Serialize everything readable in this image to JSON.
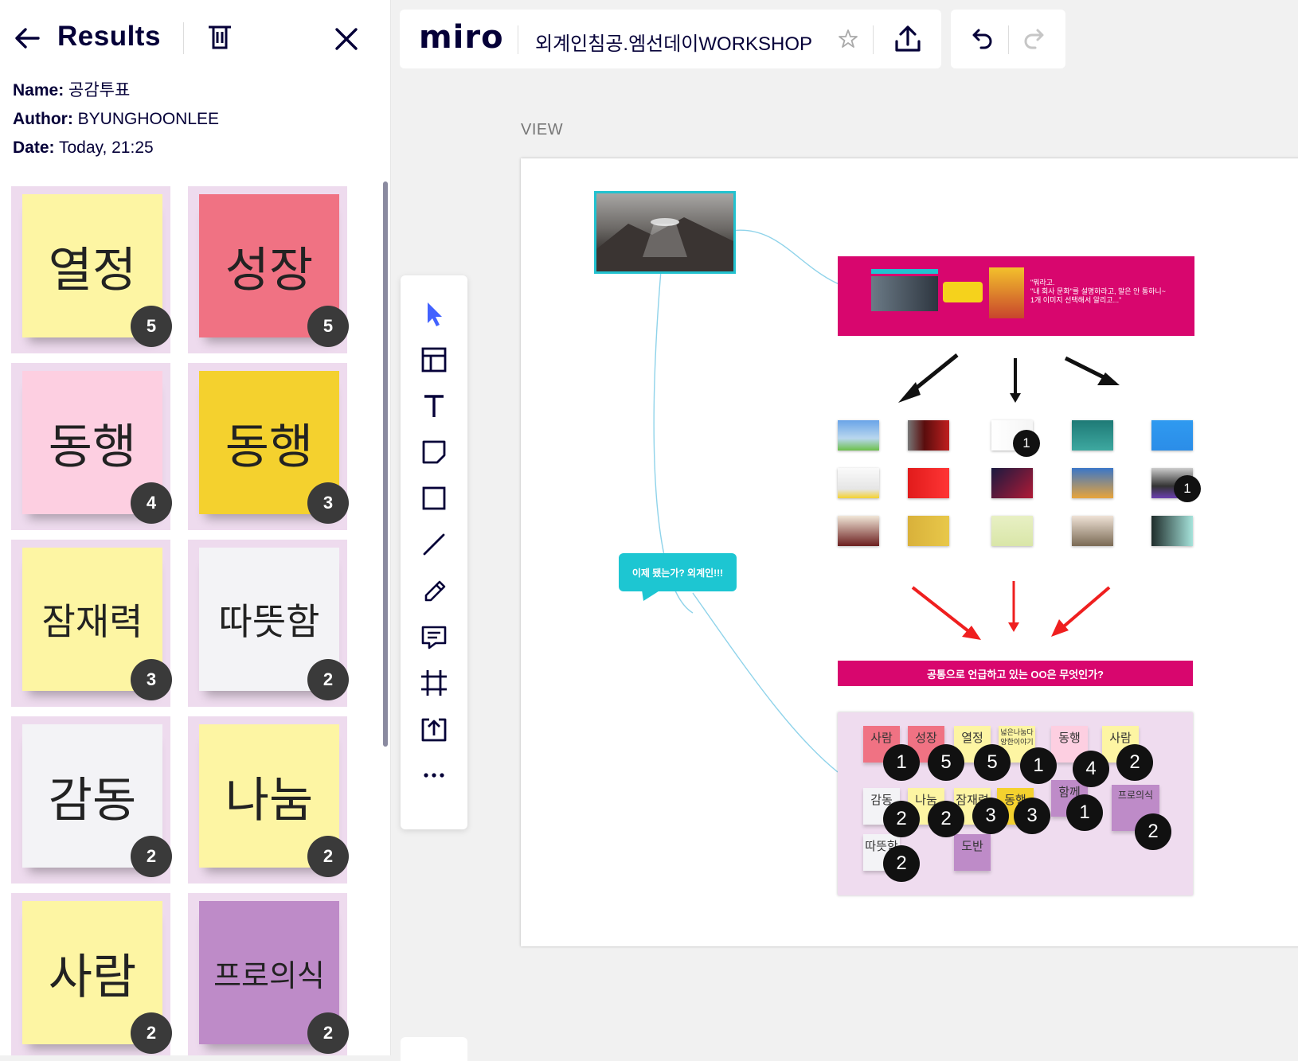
{
  "panel": {
    "title": "Results",
    "meta": [
      {
        "label": "Name:",
        "value": "공감투표"
      },
      {
        "label": "Author:",
        "value": "BYUNGHOONLEE"
      },
      {
        "label": "Date:",
        "value": "Today, 21:25"
      }
    ],
    "results": [
      {
        "word": "열정",
        "votes": "5",
        "color": "#fdf5a3"
      },
      {
        "word": "성장",
        "votes": "5",
        "color": "#f07283"
      },
      {
        "word": "동행",
        "votes": "4",
        "color": "#fdcfe1"
      },
      {
        "word": "동행",
        "votes": "3",
        "color": "#f4d12e"
      },
      {
        "word": "잠재력",
        "votes": "3",
        "color": "#fdf5a3"
      },
      {
        "word": "따뜻함",
        "votes": "2",
        "color": "#f3f3f6"
      },
      {
        "word": "감동",
        "votes": "2",
        "color": "#f3f3f6"
      },
      {
        "word": "나눔",
        "votes": "2",
        "color": "#fdf5a3"
      },
      {
        "word": "사람",
        "votes": "2",
        "color": "#fdf5a3"
      },
      {
        "word": "프로의식",
        "votes": "2",
        "color": "#be8bc8"
      }
    ]
  },
  "topbar": {
    "logo": "miro",
    "board_name": "외계인침공.엠선데이WORKSHOP"
  },
  "canvas": {
    "view_label": "VIEW",
    "magenta_quote": "\"뭐라고.\n\"내 회사 문화\"를 설명하라고, 말은 안 통하니~\n1개 이미지 선택해서 알리고...\"",
    "question": "공통으로 언급하고 있는 OO은 무엇인가?",
    "speech": "이제 됐는가? 외계인!!!",
    "thumb_votes": [
      "1",
      "1"
    ],
    "vote_notes": [
      {
        "text": "사람",
        "color": "#f07283"
      },
      {
        "text": "성장",
        "color": "#f07283"
      },
      {
        "text": "열정",
        "color": "#fdf5a3"
      },
      {
        "text": "넓은나눔다양한이야기",
        "color": "#fdf5a3"
      },
      {
        "text": "동행",
        "color": "#fdcfe1"
      },
      {
        "text": "사람",
        "color": "#fdf5a3"
      },
      {
        "text": "감동",
        "color": "#f3f3f6"
      },
      {
        "text": "나눔",
        "color": "#fdf5a3"
      },
      {
        "text": "잠재력",
        "color": "#fdf5a3"
      },
      {
        "text": "동행",
        "color": "#f4d12e"
      },
      {
        "text": "함께",
        "color": "#be8bc8"
      },
      {
        "text": "프로의식",
        "color": "#be8bc8"
      },
      {
        "text": "따뜻함",
        "color": "#f3f3f6"
      },
      {
        "text": "도반",
        "color": "#be8bc8"
      }
    ],
    "vote_counts": [
      "1",
      "5",
      "5",
      "1",
      "4",
      "2",
      "2",
      "2",
      "3",
      "3",
      "1",
      "2",
      "2"
    ]
  }
}
